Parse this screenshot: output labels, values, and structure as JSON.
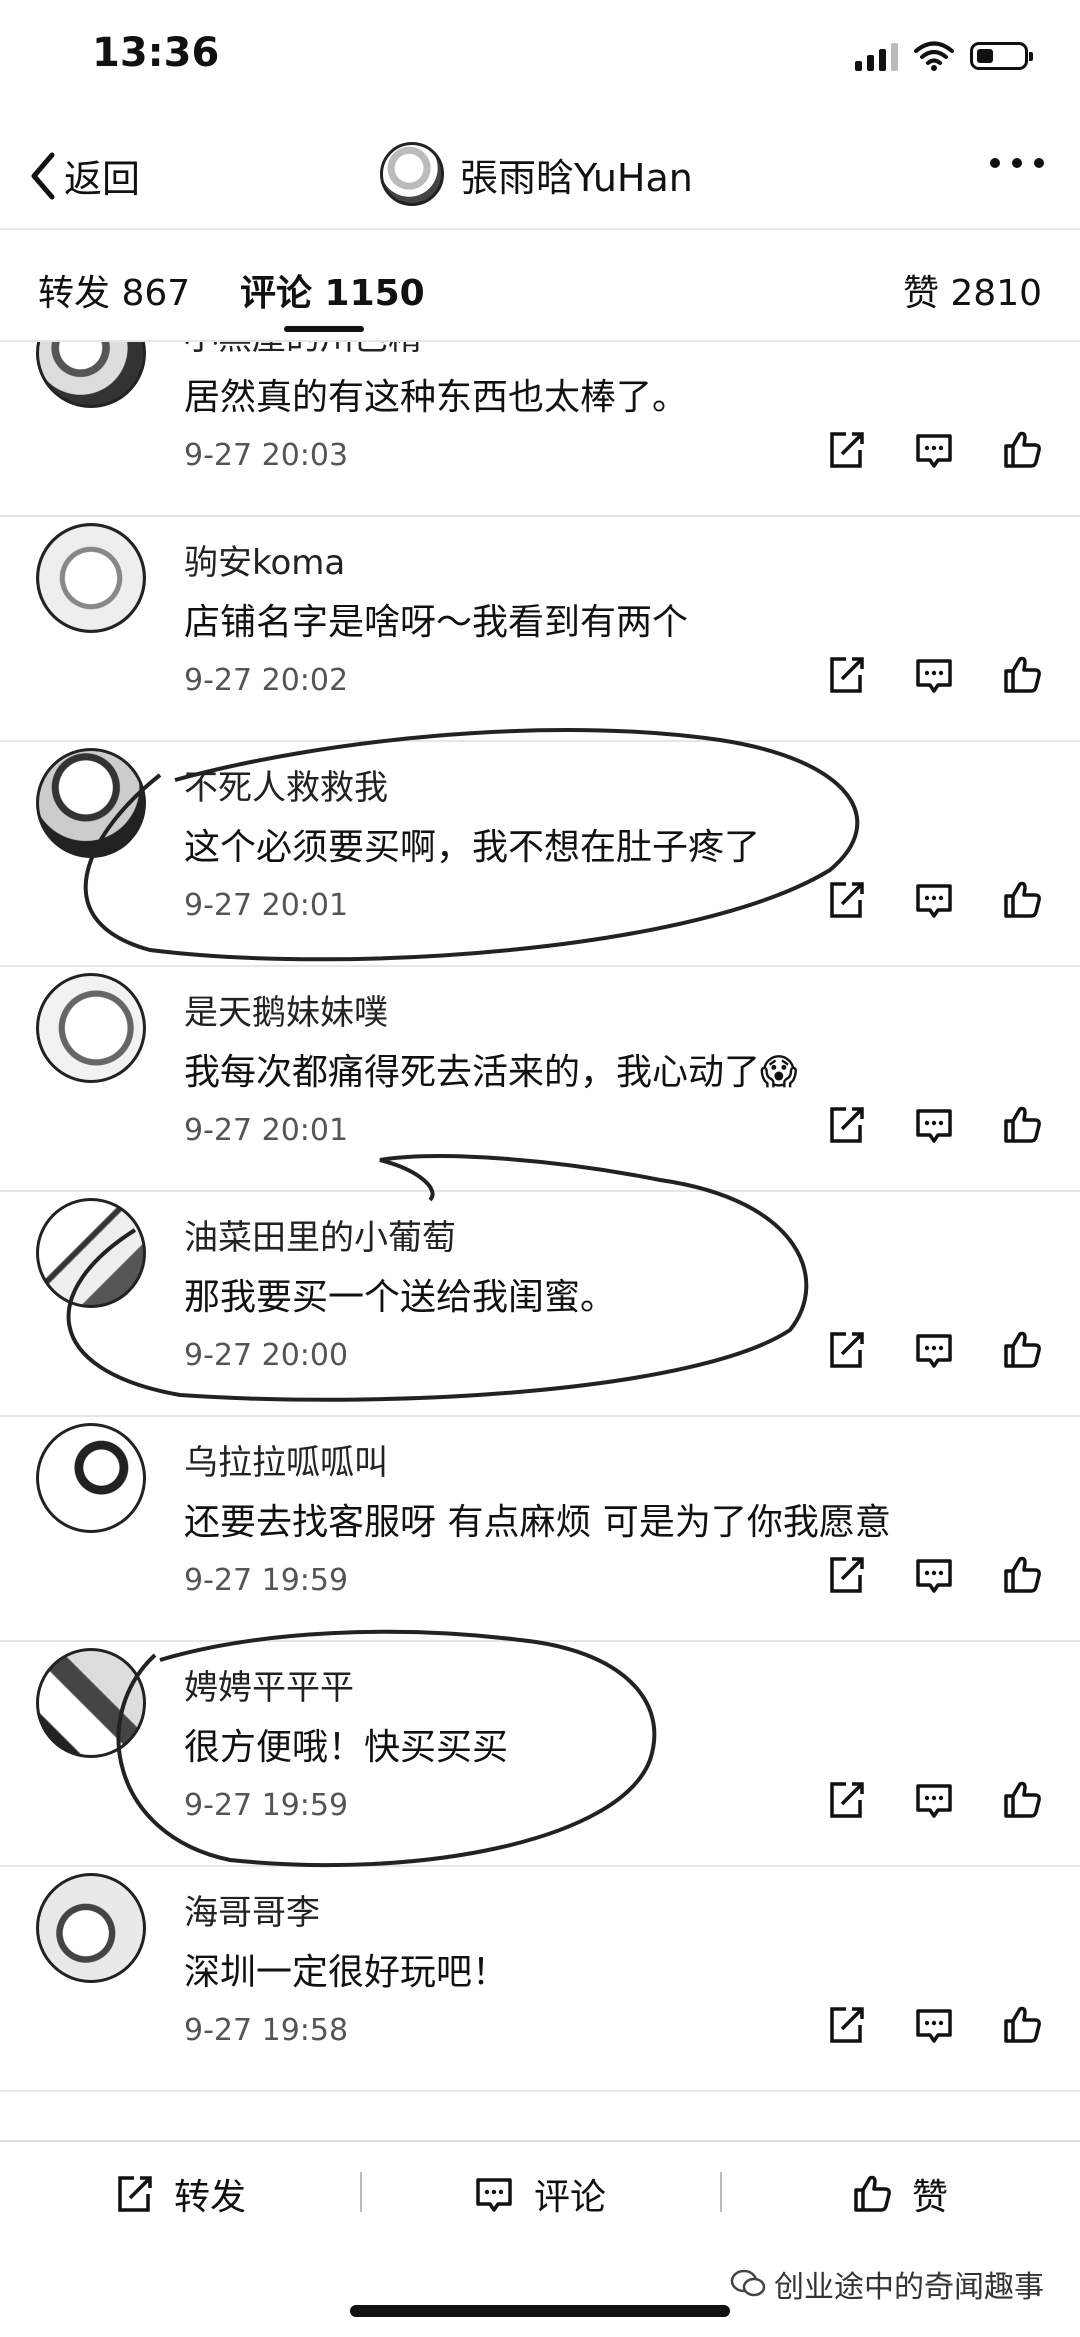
{
  "status_bar": {
    "time": "13:36"
  },
  "nav": {
    "back_label": "返回",
    "title": "張雨晗YuHan"
  },
  "tabs": {
    "repost": "转发 867",
    "comments": "评论 1150",
    "likes": "赞 2810"
  },
  "comments": [
    {
      "user": "小黑屋的川芭精",
      "text": "居然真的有这种东西也太棒了。",
      "time": "9-27 20:03"
    },
    {
      "user": "驹安koma",
      "text": "店铺名字是啥呀～我看到有两个",
      "time": "9-27 20:02"
    },
    {
      "user": "不死人救救我",
      "text": "这个必须要买啊，我不想在肚子疼了",
      "time": "9-27 20:01"
    },
    {
      "user": "是天鹅妹妹噗",
      "text": "我每次都痛得死去活来的，我心动了😱",
      "time": "9-27 20:01"
    },
    {
      "user": "油菜田里的小葡萄",
      "text": "那我要买一个送给我闺蜜。",
      "time": "9-27 20:00"
    },
    {
      "user": "乌拉拉呱呱叫",
      "text": "还要去找客服呀 有点麻烦 可是为了你我愿意",
      "time": "9-27 19:59"
    },
    {
      "user": "娉娉平平平",
      "text": "很方便哦！快买买买",
      "time": "9-27 19:59"
    },
    {
      "user": "海哥哥李",
      "text": "深圳一定很好玩吧！",
      "time": "9-27 19:58"
    }
  ],
  "bottom_bar": {
    "repost": "转发",
    "comment": "评论",
    "like": "赞"
  },
  "watermark": "创业途中的奇闻趣事"
}
